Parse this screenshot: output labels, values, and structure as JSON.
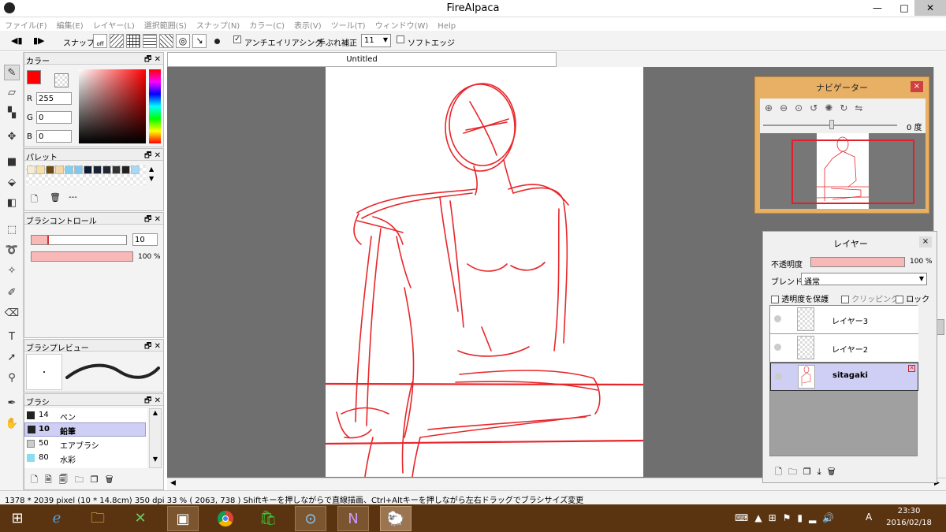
{
  "window": {
    "title": "FireAlpaca",
    "minimize": "—",
    "maximize": "□",
    "close": "✕"
  },
  "menu": [
    "ファイル(F)",
    "編集(E)",
    "レイヤー(L)",
    "選択範囲(S)",
    "スナップ(N)",
    "カラー(C)",
    "表示(V)",
    "ツール(T)",
    "ウィンドウ(W)",
    "Help"
  ],
  "toolbar": {
    "snap_label": "スナップ",
    "snap_off": "off",
    "antialias_label": "アンチエイリアシング",
    "antialias_checked": true,
    "stabilizer_label": "手ぶれ補正",
    "stabilizer_value": "11",
    "soft_edge_label": "ソフトエッジ",
    "soft_edge_checked": false
  },
  "color_panel": {
    "title": "カラー",
    "r_label": "R",
    "r_value": "255",
    "g_label": "G",
    "g_value": "0",
    "b_label": "B",
    "b_value": "0",
    "fg_color": "#ff0000"
  },
  "palette_panel": {
    "title": "パレット",
    "swatches": [
      "#f6edd0",
      "#f8e0a0",
      "#6b4a10",
      "#f4d8a8",
      "#7fd0ee",
      "#7fc8f0",
      "#0f1a33",
      "#1a2233",
      "#222831",
      "#333333",
      "#222222",
      "#a9d8f5"
    ],
    "name": "---"
  },
  "brush_control": {
    "title": "ブラシコントロール",
    "size_value": "10",
    "size_fraction": 0.18,
    "opacity_value": "100 %"
  },
  "brush_preview": {
    "title": "ブラシプレビュー"
  },
  "brush_panel": {
    "title": "ブラシ",
    "items": [
      {
        "size": "14",
        "name": "ペン",
        "selected": false,
        "swatch": "#222222"
      },
      {
        "size": "10",
        "name": "鉛筆",
        "selected": true,
        "swatch": "#222222"
      },
      {
        "size": "50",
        "name": "エアブラシ",
        "selected": false,
        "swatch": "#cccccc"
      },
      {
        "size": "80",
        "name": "水彩",
        "selected": false,
        "swatch": "#88ddee"
      }
    ]
  },
  "document": {
    "tab_title": "Untitled"
  },
  "navigator": {
    "title": "ナビゲーター",
    "close": "×",
    "angle": "0 度"
  },
  "layer_panel": {
    "title": "レイヤー",
    "close": "×",
    "opacity_label": "不透明度",
    "opacity_value": "100 %",
    "blend_label": "ブレンド",
    "blend_value": "通常",
    "protect_alpha": "透明度を保護",
    "clipping": "クリッピング",
    "lock": "ロック",
    "layers": [
      {
        "name": "レイヤー3",
        "selected": false
      },
      {
        "name": "レイヤー2",
        "selected": false
      },
      {
        "name": "sitagaki",
        "selected": true
      }
    ]
  },
  "status": {
    "text": "1378 * 2039 pixel   (10 * 14.8cm)   350 dpi   33 %   ( 2063, 738 )   Shiftキーを押しながらで直線描画、Ctrl+Altキーを押しながら左右ドラッグでブラシサイズ変更"
  },
  "taskbar": {
    "time": "23:30",
    "date": "2016/02/18",
    "ime": "A"
  }
}
